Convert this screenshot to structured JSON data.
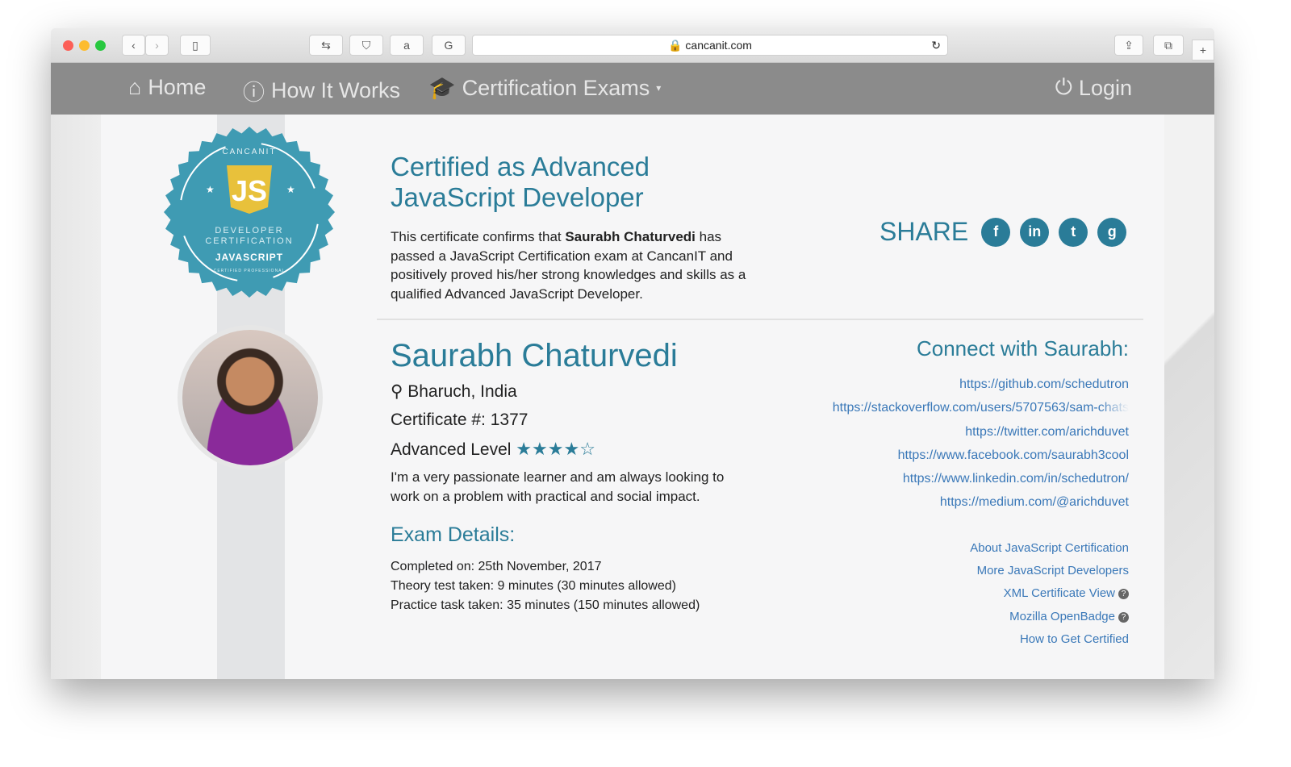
{
  "browser": {
    "url": "cancanit.com"
  },
  "nav": {
    "home": "Home",
    "how": "How It Works",
    "exams": "Certification Exams",
    "login": "Login"
  },
  "badge": {
    "brand": "CANCANIT",
    "line1": "DEVELOPER",
    "line2": "CERTIFICATION",
    "line3": "JAVASCRIPT",
    "line4": "CERTIFIED PROFESSIONAL"
  },
  "cert": {
    "title": "Certified as Advanced JavaScript Developer",
    "desc_pre": "This certificate confirms that ",
    "desc_name": "Saurabh Chaturvedi",
    "desc_post": " has passed a JavaScript Certification exam at CancanIT and positively proved his/her strong knowledges and skills as a qualified Advanced JavaScript Developer."
  },
  "share": {
    "label": "SHARE",
    "icons": [
      "facebook-icon",
      "linkedin-icon",
      "twitter-icon",
      "google-plus-icon"
    ]
  },
  "profile": {
    "name": "Saurabh Chaturvedi",
    "location": "Bharuch, India",
    "certificate": "Certificate #: 1377",
    "level": "Advanced Level",
    "rating": 4,
    "rating_max": 5,
    "bio": "I'm a very passionate learner and am always looking to work on a problem with practical and social impact."
  },
  "exam": {
    "heading": "Exam Details:",
    "completed": "Completed on: 25th November, 2017",
    "theory": "Theory test taken: 9 minutes (30 minutes allowed)",
    "practice": "Practice task taken: 35 minutes (150 minutes allowed)"
  },
  "connect": {
    "heading": "Connect with Saurabh:",
    "links": [
      "https://github.com/schedutron",
      "https://stackoverflow.com/users/5707563/sam-chats",
      "https://twitter.com/arichduvet",
      "https://www.facebook.com/saurabh3cool",
      "https://www.linkedin.com/in/schedutron/",
      "https://medium.com/@arichduvet"
    ]
  },
  "more": {
    "about": "About JavaScript Certification",
    "devs": "More JavaScript Developers",
    "xml": "XML Certificate View",
    "badge": "Mozilla OpenBadge",
    "how": "How to Get Certified"
  },
  "colors": {
    "accent": "#2a7c98",
    "link": "#3a78b8",
    "nav": "#8b8b8b"
  }
}
